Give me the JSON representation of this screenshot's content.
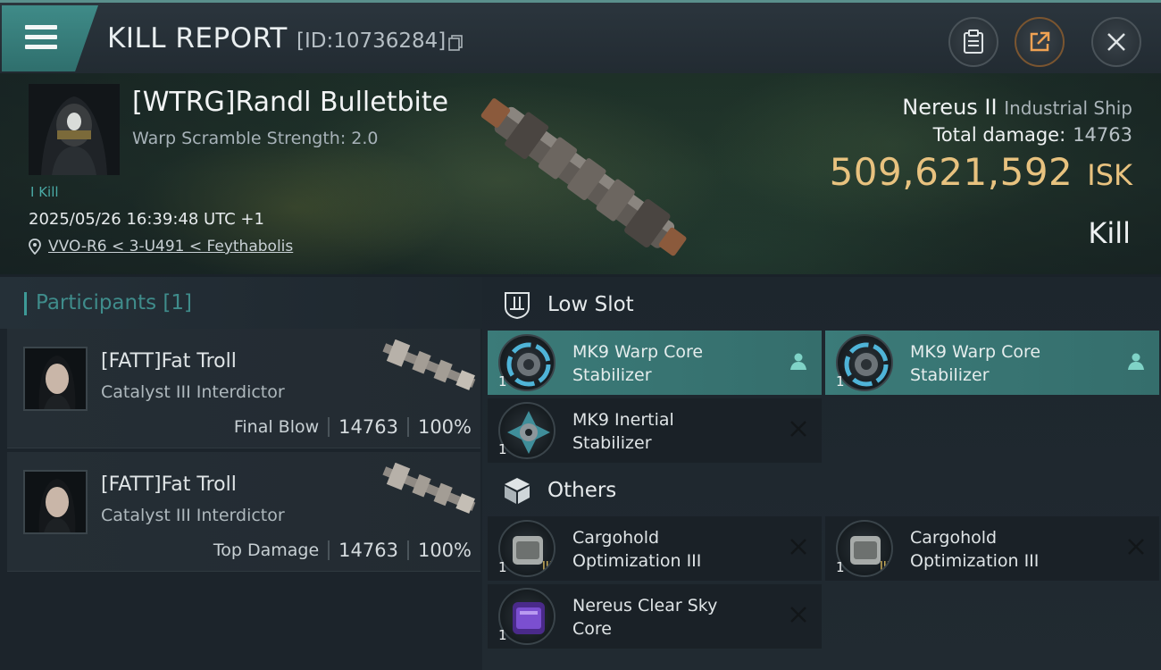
{
  "header": {
    "title": "KILL REPORT",
    "report_id": "[ID:10736284]"
  },
  "victim": {
    "name": "[WTRG]Randl Bulletbite",
    "warp_scramble": "Warp Scramble Strength: 2.0",
    "kill_tag": "I Kill",
    "timestamp": "2025/05/26 16:39:48 UTC +1",
    "location": "VVO-R6 < 3-U491 < Feythabolis",
    "ship_name": "Nereus II",
    "ship_class": "Industrial Ship",
    "total_damage_label": "Total damage:",
    "total_damage": "14763",
    "isk_value": "509,621,592",
    "isk_unit": "ISK",
    "result": "Kill"
  },
  "participants": {
    "title": "Participants",
    "count": "[1]",
    "items": [
      {
        "name": "[FATT]Fat Troll",
        "ship": "Catalyst III Interdictor",
        "role": "Final Blow",
        "damage": "14763",
        "percent": "100%"
      },
      {
        "name": "[FATT]Fat Troll",
        "ship": "Catalyst III Interdictor",
        "role": "Top Damage",
        "damage": "14763",
        "percent": "100%"
      }
    ]
  },
  "fitting": {
    "low_slot": {
      "label": "Low Slot",
      "modules": [
        {
          "name_line1": "MK9 Warp Core",
          "name_line2": "Stabilizer",
          "qty": "1",
          "status": "dropped"
        },
        {
          "name_line1": "MK9 Warp Core",
          "name_line2": "Stabilizer",
          "qty": "1",
          "status": "dropped"
        },
        {
          "name_line1": "MK9 Inertial",
          "name_line2": "Stabilizer",
          "qty": "1",
          "status": "destroyed"
        }
      ]
    },
    "others": {
      "label": "Others",
      "modules": [
        {
          "name_line1": "Cargohold",
          "name_line2": "Optimization III",
          "qty": "1",
          "status": "destroyed"
        },
        {
          "name_line1": "Cargohold",
          "name_line2": "Optimization III",
          "qty": "1",
          "status": "destroyed"
        },
        {
          "name_line1": "Nereus Clear Sky",
          "name_line2": "Core",
          "qty": "1",
          "status": "destroyed"
        }
      ]
    }
  },
  "icons": {
    "menu": "hamburger-icon",
    "copy": "copy-icon",
    "clipboard": "clipboard-icon",
    "share": "share-icon",
    "close": "close-icon",
    "location": "location-pin-icon",
    "low_slot": "low-slot-icon",
    "others": "cube-icon",
    "dropped": "person-icon",
    "destroyed": "x-icon"
  },
  "colors": {
    "accent": "#3d8c8a",
    "isk": "#e8c27f",
    "active_module": "#3b7b79"
  }
}
